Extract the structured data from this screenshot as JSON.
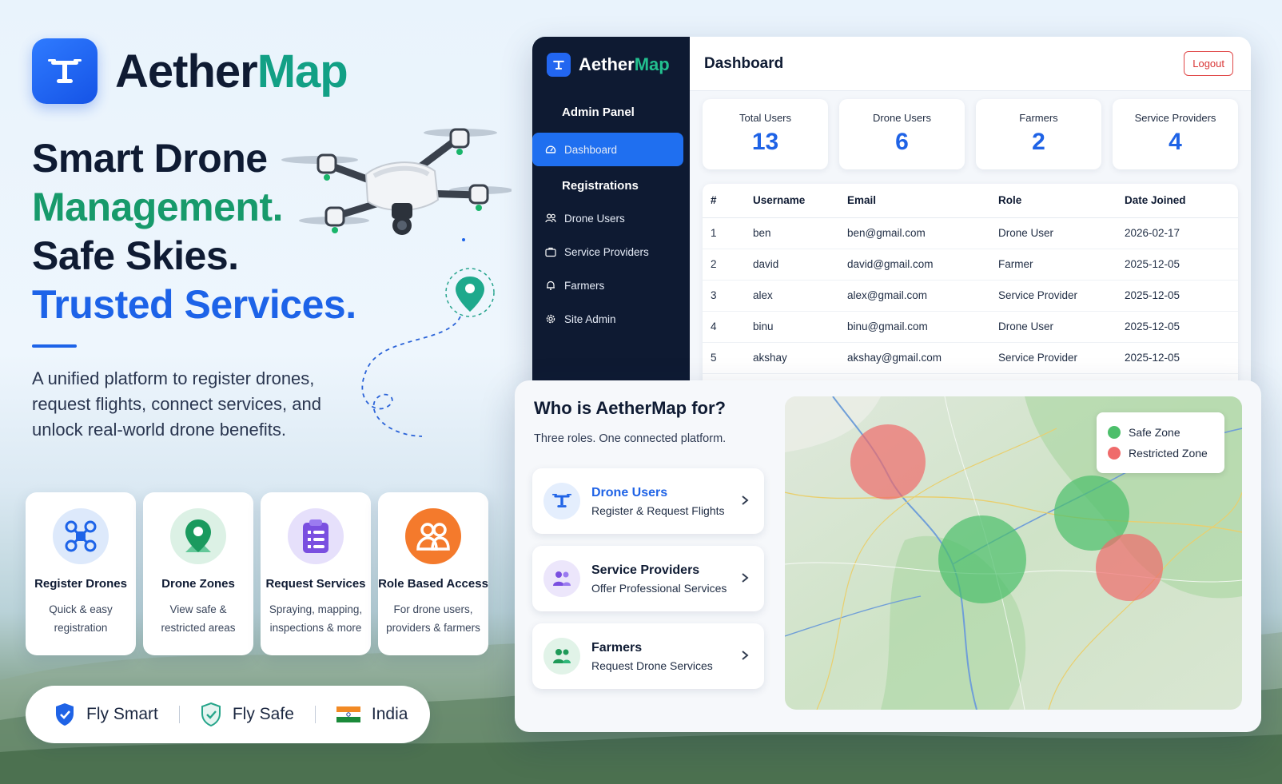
{
  "brand": {
    "part1": "Aether",
    "part2": "Map"
  },
  "hero": {
    "line1": "Smart Drone",
    "line2": "Management.",
    "line3": "Safe Skies.",
    "line4": "Trusted Services.",
    "subtext": "A unified platform to register drones, request flights, connect services, and unlock real-world drone benefits."
  },
  "features": [
    {
      "title": "Register Drones",
      "desc": "Quick & easy registration",
      "icon": "drone-icon"
    },
    {
      "title": "Drone Zones",
      "desc": "View safe & restricted areas",
      "icon": "map-pin-icon"
    },
    {
      "title": "Request Services",
      "desc": "Spraying, mapping, inspections & more",
      "icon": "clipboard-icon"
    },
    {
      "title": "Role Based Access",
      "desc": "For drone users, providers & farmers",
      "icon": "users-icon"
    }
  ],
  "badges": {
    "fly_smart": "Fly Smart",
    "fly_safe": "Fly Safe",
    "india": "India"
  },
  "dashboard": {
    "logo_part1": "Aether",
    "logo_part2": "Map",
    "admin_panel": "Admin Panel",
    "nav_dashboard": "Dashboard",
    "registrations": "Registrations",
    "nav_drone_users": "Drone Users",
    "nav_service_providers": "Service Providers",
    "nav_farmers": "Farmers",
    "nav_site_admin": "Site Admin",
    "title": "Dashboard",
    "logout": "Logout",
    "stats": [
      {
        "label": "Total Users",
        "value": "13"
      },
      {
        "label": "Drone Users",
        "value": "6"
      },
      {
        "label": "Farmers",
        "value": "2"
      },
      {
        "label": "Service Providers",
        "value": "4"
      }
    ],
    "table": {
      "headers": [
        "#",
        "Username",
        "Email",
        "Role",
        "Date Joined"
      ],
      "rows": [
        [
          "1",
          "ben",
          "ben@gmail.com",
          "Drone User",
          "2026-02-17"
        ],
        [
          "2",
          "david",
          "david@gmail.com",
          "Farmer",
          "2025-12-05"
        ],
        [
          "3",
          "alex",
          "alex@gmail.com",
          "Service Provider",
          "2025-12-05"
        ],
        [
          "4",
          "binu",
          "binu@gmail.com",
          "Drone User",
          "2025-12-05"
        ],
        [
          "5",
          "akshay",
          "akshay@gmail.com",
          "Service Provider",
          "2025-12-05"
        ]
      ]
    }
  },
  "who": {
    "title": "Who is AetherMap for?",
    "subtitle": "Three roles. One connected platform.",
    "roles": [
      {
        "title": "Drone Users",
        "desc": "Register & Request Flights"
      },
      {
        "title": "Service Providers",
        "desc": "Offer Professional Services"
      },
      {
        "title": "Farmers",
        "desc": "Request Drone Services"
      }
    ],
    "legend": {
      "safe": "Safe Zone",
      "restricted": "Restricted Zone"
    }
  },
  "colors": {
    "brand_blue": "#1d63e8",
    "brand_green": "#179a6b",
    "sidebar": "#0e1a32",
    "safe_zone": "#4cbf6b",
    "restricted_zone": "#ef6b6b",
    "logout": "#d93636"
  }
}
